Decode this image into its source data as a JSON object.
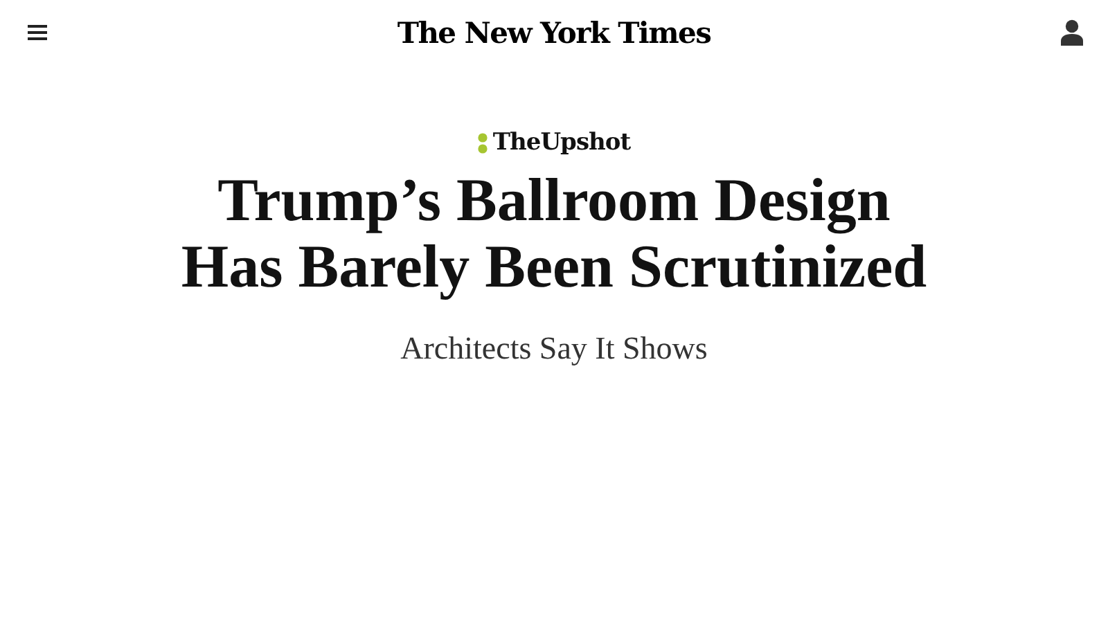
{
  "header": {
    "logo": "The New York Times"
  },
  "section": {
    "label": "TheUpshot"
  },
  "article": {
    "headline": "Trump’s Ballroom Design Has Barely Been Scrutinized",
    "subheadline": "Architects Say It Shows"
  }
}
